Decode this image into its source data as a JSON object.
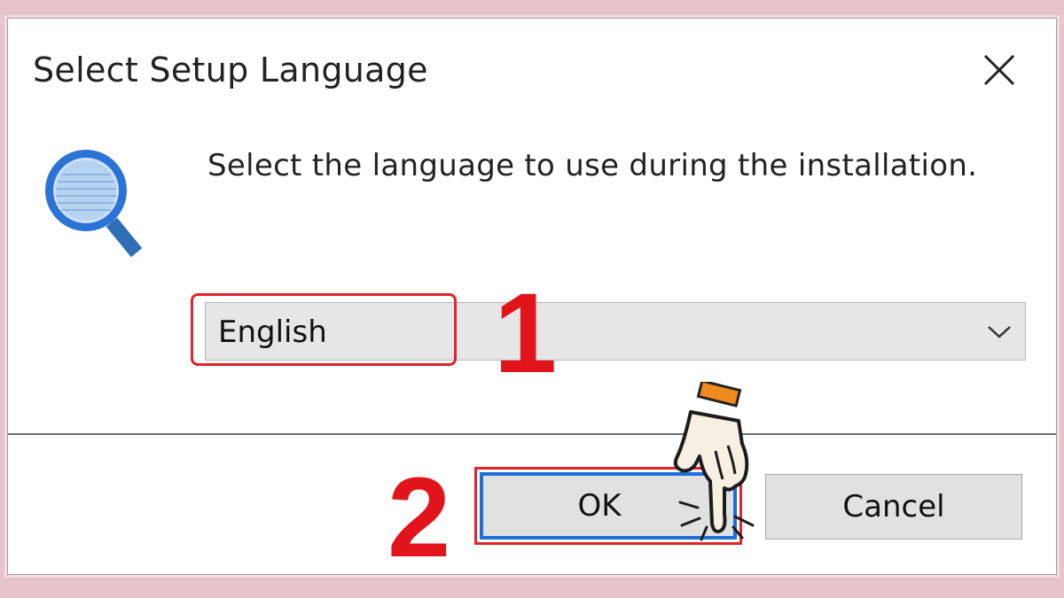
{
  "dialog": {
    "title": "Select Setup Language",
    "prompt": "Select the language to use during the installation.",
    "language_select": {
      "selected": "English"
    },
    "buttons": {
      "ok_label": "OK",
      "cancel_label": "Cancel"
    }
  },
  "annotations": {
    "step1": "1",
    "step2": "2",
    "highlight_color": "#e0242c"
  },
  "icons": {
    "close": "close-icon",
    "app": "magnifier-icon",
    "dropdown": "chevron-down-icon",
    "pointer": "hand-pointer-icon"
  },
  "colors": {
    "accent": "#1e6fd9",
    "annotation": "#e1141c",
    "background": "#e8c4ca"
  }
}
